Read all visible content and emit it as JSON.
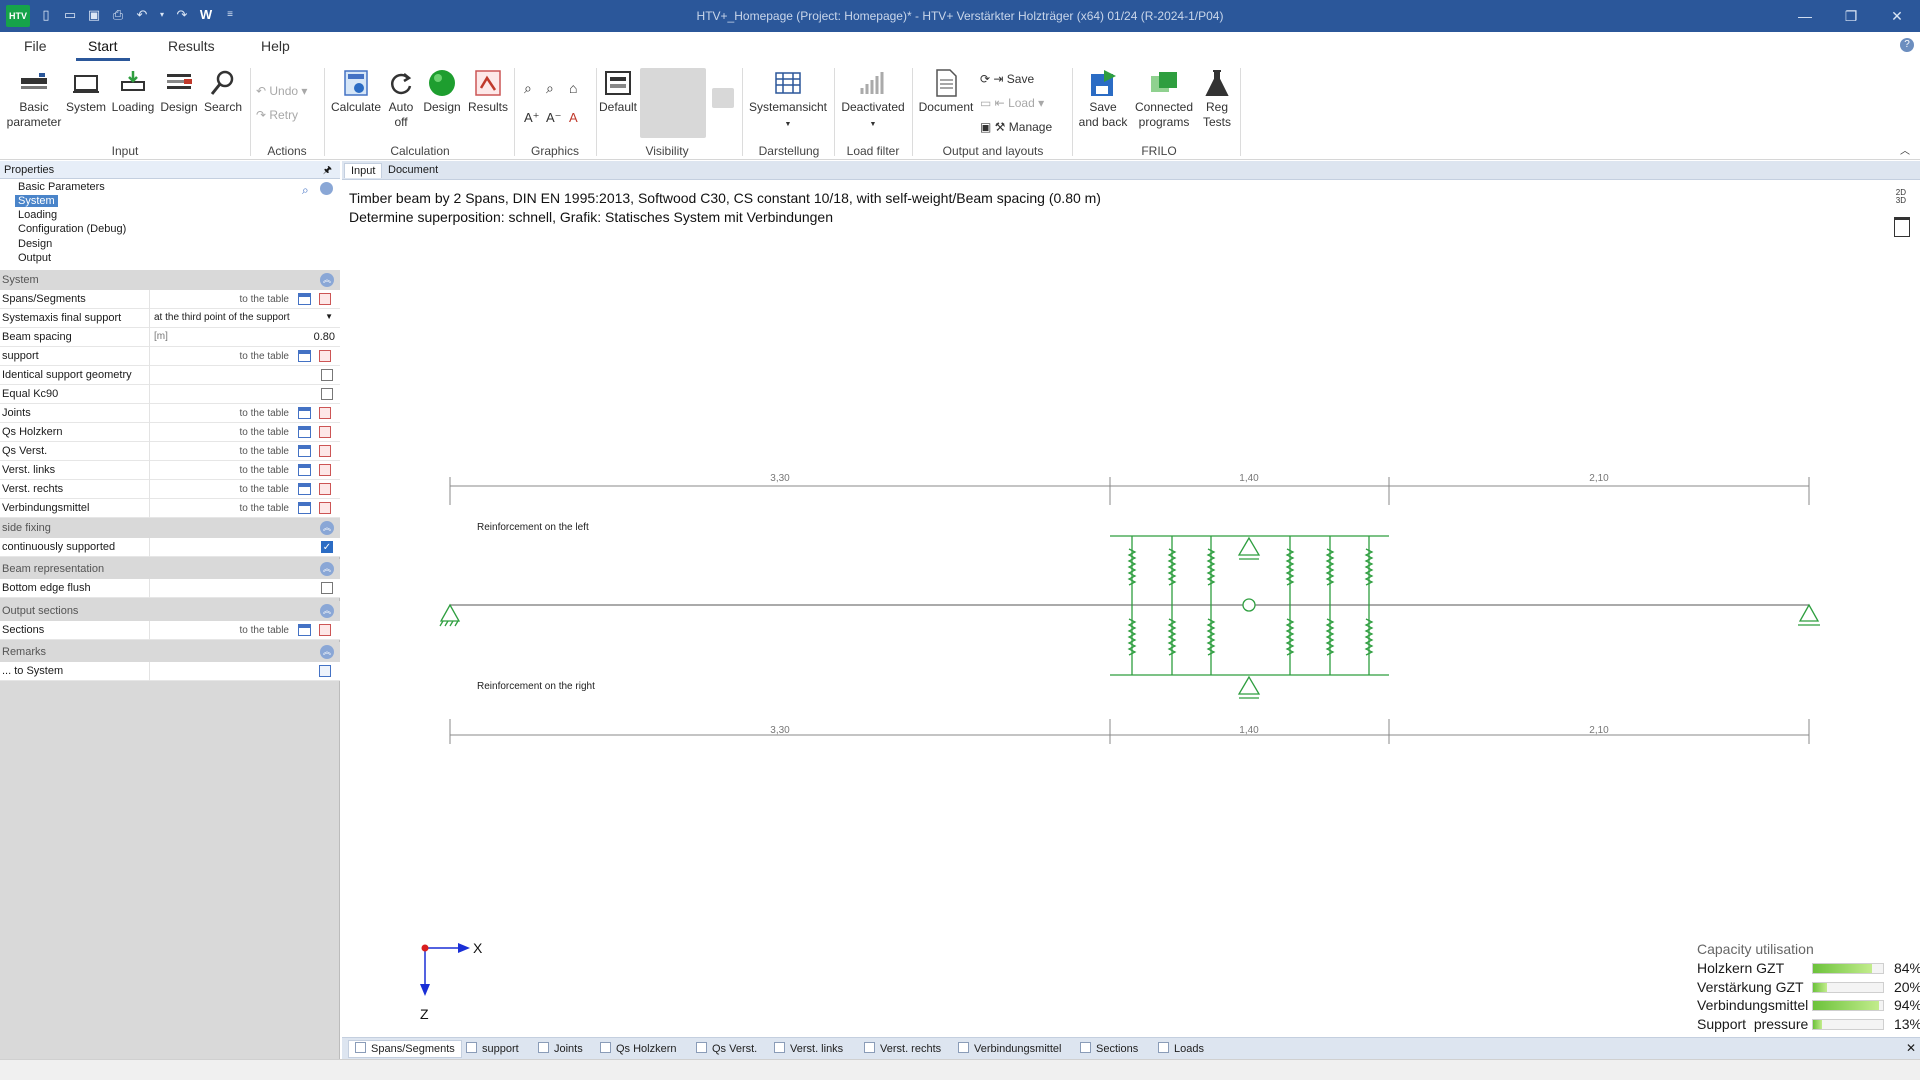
{
  "titlebar": {
    "logo": "HTV",
    "title": "HTV+_Homepage (Project: Homepage)* - HTV+ Verstärkter Holzträger (x64) 01/24 (R-2024-1/P04)",
    "qat_w": "W"
  },
  "menu_tabs": [
    "File",
    "Start",
    "Results",
    "Help"
  ],
  "ribbon": {
    "input": {
      "label": "Input",
      "basic_parameter": "Basic\nparameter",
      "system": "System",
      "loading": "Loading",
      "design": "Design",
      "search": "Search"
    },
    "actions": {
      "label": "Actions",
      "undo": "Undo",
      "retry": "Retry"
    },
    "calculation": {
      "label": "Calculation",
      "calculate": "Calculate",
      "auto_off": "Auto\noff",
      "design": "Design",
      "results": "Results"
    },
    "graphics": {
      "label": "Graphics"
    },
    "visibility": {
      "label": "Visibility",
      "default": "Default"
    },
    "darstellung": {
      "label": "Darstellung",
      "systemansicht": "Systemansicht"
    },
    "load_filter": {
      "label": "Load filter",
      "deactivated": "Deactivated"
    },
    "output": {
      "label": "Output and layouts",
      "document": "Document",
      "save": "Save",
      "load": "Load",
      "manage": "Manage"
    },
    "frilo": {
      "label": "FRILO",
      "save_and_back": "Save\nand back",
      "connected_programs": "Connected\nprograms",
      "reg_tests": "Reg\nTests"
    }
  },
  "properties": {
    "header": "Properties",
    "tree": [
      "Basic Parameters",
      "System",
      "Loading",
      "Configuration (Debug)",
      "Design",
      "Output"
    ],
    "to_the_table": "to the table",
    "sections": {
      "system": "System",
      "side_fixing": "side fixing",
      "beam_representation": "Beam representation",
      "output_sections": "Output sections",
      "remarks": "Remarks"
    },
    "rows": {
      "spans": "Spans/Segments",
      "systemaxis": "Systemaxis final support",
      "systemaxis_value": "at the third point of the support",
      "beam_spacing": "Beam spacing",
      "beam_spacing_unit": "[m]",
      "beam_spacing_value": "0.80",
      "support": "support",
      "identical_support": "Identical support geometry",
      "equal_kc90": "Equal Kc90",
      "joints": "Joints",
      "qs_holzkern": "Qs Holzkern",
      "qs_verst": "Qs Verst.",
      "verst_links": "Verst. links",
      "verst_rechts": "Verst. rechts",
      "verbindungsmittel": "Verbindungsmittel",
      "continuously_supported": "continuously supported",
      "bottom_edge_flush": "Bottom edge flush",
      "sections": "Sections",
      "to_system": "... to System"
    }
  },
  "doc_tabs": [
    "Input",
    "Document"
  ],
  "content": {
    "description_1": "Timber beam by 2 Spans, DIN EN 1995:2013, Softwood C30, CS constant 10/18, with self-weight/Beam spacing (0.80 m)",
    "description_2": "Determine superposition: schnell, Grafik: Statisches System mit Verbindungen",
    "view_toggle": "2D\n3D",
    "dims_top": [
      "3,30",
      "1,40",
      "2,10"
    ],
    "dims_bottom": [
      "3,30",
      "1,40",
      "2,10"
    ],
    "reinforcement_left": "Reinforcement on the left",
    "reinforcement_right": "Reinforcement on the right",
    "axis_x": "X",
    "axis_z": "Z"
  },
  "capacity": {
    "title": "Capacity utilisation",
    "rows": [
      {
        "label": "Holzkern GZT",
        "value": 84,
        "text": "84%"
      },
      {
        "label": "Verstärkung GZT",
        "value": 20,
        "text": "20%"
      },
      {
        "label": "Verbindungsmittel",
        "value": 94,
        "text": "94%"
      },
      {
        "label": "Support  pressure",
        "value": 13,
        "text": "13%"
      }
    ]
  },
  "bottom_tabs": [
    "Spans/Segments",
    "support",
    "Joints",
    "Qs Holzkern",
    "Qs Verst.",
    "Verst. links",
    "Verst. rechts",
    "Verbindungsmittel",
    "Sections",
    "Loads"
  ],
  "colors": {
    "titlebar": "#2b579a",
    "accent": "#2b579a",
    "drawing": "#2e9e3f",
    "selection": "#4a84c9"
  }
}
